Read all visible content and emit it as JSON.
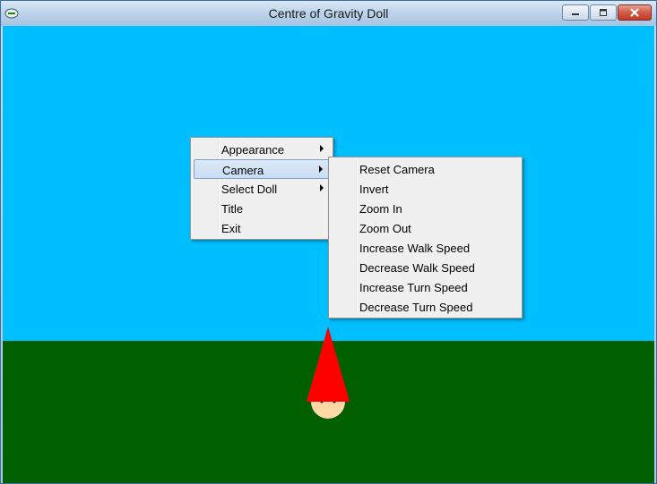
{
  "window": {
    "title": "Centre of Gravity Doll",
    "icon": "app-icon",
    "controls": [
      "minimize-icon",
      "maximize-icon",
      "close-icon"
    ]
  },
  "scene": {
    "sky_color": "#00bfff",
    "ground_color": "#006000",
    "doll_hat_color": "#ff0000",
    "doll_face_color": "#ffd8a8"
  },
  "context_menu": {
    "items": [
      {
        "label": "Appearance",
        "submenu": true
      },
      {
        "label": "Camera",
        "submenu": true,
        "highlighted": true
      },
      {
        "label": "Select Doll",
        "submenu": true
      },
      {
        "label": "Title",
        "submenu": false
      },
      {
        "label": "Exit",
        "submenu": false
      }
    ]
  },
  "camera_submenu": {
    "items": [
      {
        "label": "Reset Camera"
      },
      {
        "label": "Invert"
      },
      {
        "label": "Zoom In"
      },
      {
        "label": "Zoom Out"
      },
      {
        "label": "Increase Walk Speed"
      },
      {
        "label": "Decrease Walk Speed"
      },
      {
        "label": "Increase Turn Speed"
      },
      {
        "label": "Decrease Turn Speed"
      }
    ]
  }
}
